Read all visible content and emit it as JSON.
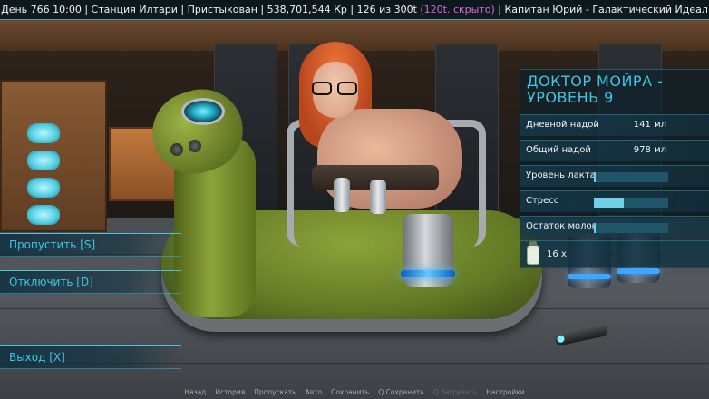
{
  "status_bar": {
    "day": "День 766",
    "time": "10:00",
    "station": "Станция Илтари",
    "dock_status": "Пристыкован",
    "credits": "538,701,544 Кр",
    "capacity": "126 из 300t",
    "hidden": "(120t. скрыто)",
    "captain": "Капитан Юрий - Галактический Идеал",
    "accent_color": "#3ec6e6"
  },
  "stats_panel": {
    "title": "ДОКТОР МОЙРА - УРОВЕНЬ 9",
    "daily_yield": {
      "label": "Дневной надой",
      "value": "141 мл"
    },
    "total_yield": {
      "label": "Общий надой",
      "value": "978 мл"
    },
    "lactation": {
      "label": "Уровень лактации",
      "fill": 0.02
    },
    "stress": {
      "label": "Стресс",
      "fill": 0.4
    },
    "milk_left": {
      "label": "Остаток молока",
      "fill": 0.03
    },
    "item": {
      "icon": "milk-bottle-icon",
      "count": "16 x"
    }
  },
  "menu": {
    "skip": "Пропустить [S]",
    "disable": "Отключить [D]",
    "exit": "Выход [X]"
  },
  "quick_menu": {
    "back": "Назад",
    "history": "История",
    "skip": "Пропускать",
    "auto": "Авто",
    "save": "Сохранить",
    "quick_save": "Q.Сохранить",
    "quick_load": "Q.Загрузить",
    "settings": "Настройки"
  }
}
